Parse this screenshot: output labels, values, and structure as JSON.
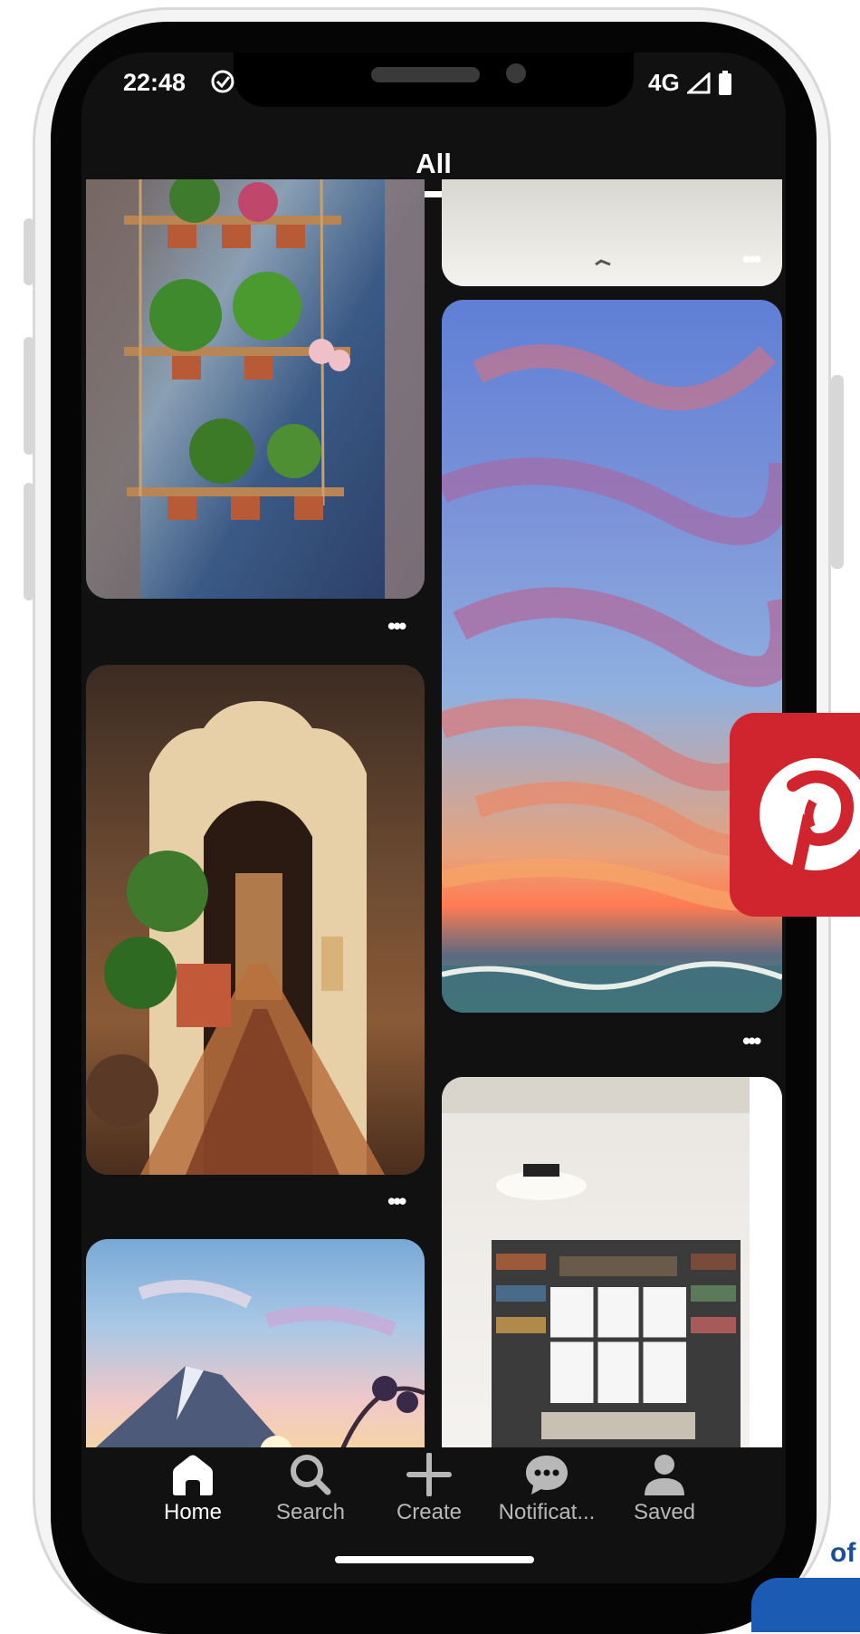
{
  "status_bar": {
    "time": "22:48",
    "network": "4G"
  },
  "feed": {
    "tab_label": "All",
    "more_label": "•••"
  },
  "pins": [
    {
      "subject": "hanging plant shelf in window"
    },
    {
      "subject": "arched hallway interior"
    },
    {
      "subject": "anime mountain sunset sky"
    },
    {
      "subject": "painted sunset clouds over sea"
    },
    {
      "subject": "reading nook with bookshelves"
    }
  ],
  "nav": {
    "items": [
      {
        "label": "Home",
        "icon": "home-icon",
        "active": true
      },
      {
        "label": "Search",
        "icon": "search-icon",
        "active": false
      },
      {
        "label": "Create",
        "icon": "plus-icon",
        "active": false
      },
      {
        "label": "Notificat...",
        "icon": "chat-bubble-icon",
        "active": false
      },
      {
        "label": "Saved",
        "icon": "person-icon",
        "active": false
      }
    ]
  },
  "colors": {
    "background": "#111111",
    "text": "#ffffff",
    "inactive_text": "#b8b8b8",
    "pinterest_red": "#d0242f"
  },
  "overlay": {
    "corner_text": "of"
  }
}
